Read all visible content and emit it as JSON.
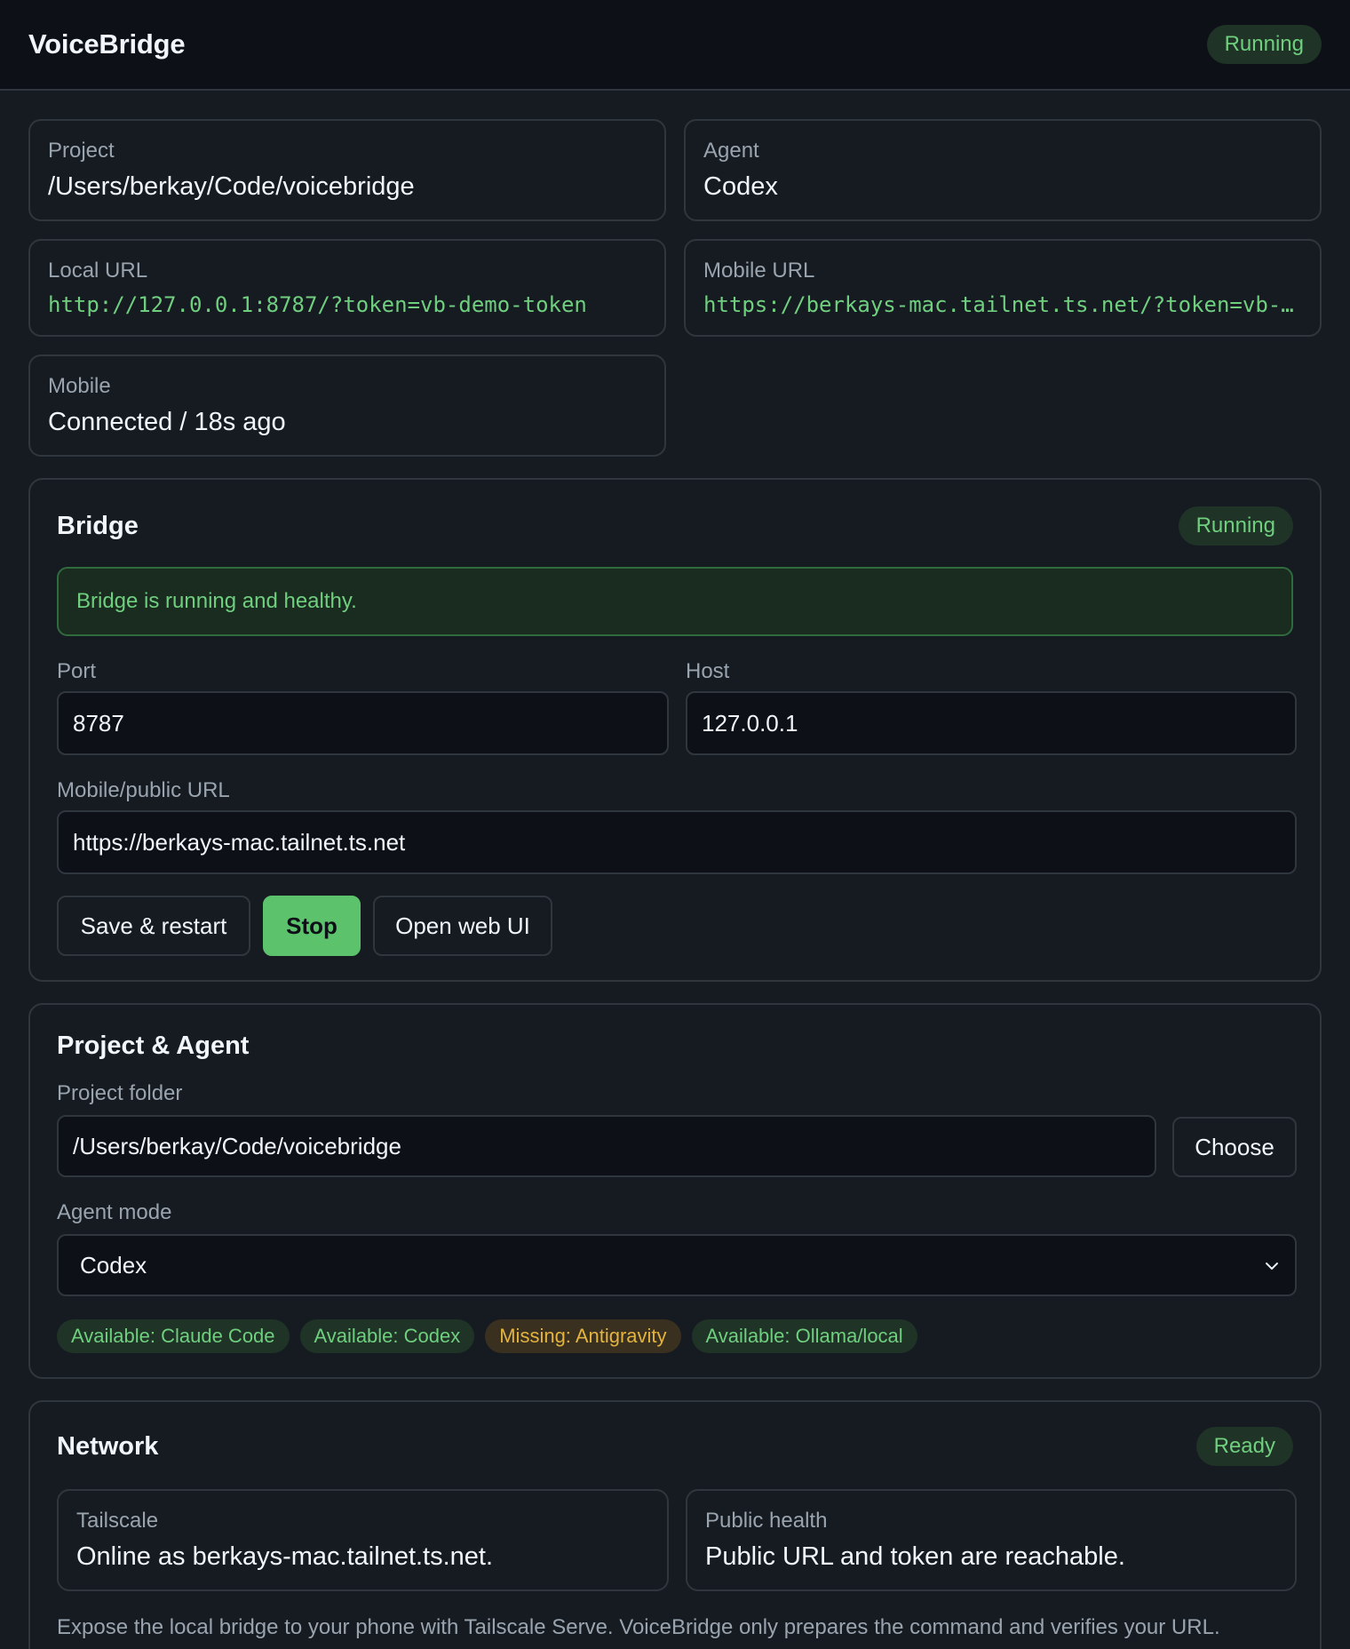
{
  "app": {
    "title": "VoiceBridge",
    "status": "Running"
  },
  "summary": {
    "project": {
      "label": "Project",
      "value": "/Users/berkay/Code/voicebridge"
    },
    "agent": {
      "label": "Agent",
      "value": "Codex"
    },
    "local_url": {
      "label": "Local URL",
      "value": "http://127.0.0.1:8787/?token=vb-demo-token"
    },
    "mobile_url": {
      "label": "Mobile URL",
      "value": "https://berkays-mac.tailnet.ts.net/?token=vb-demo-token"
    },
    "mobile": {
      "label": "Mobile",
      "value": "Connected / 18s ago"
    }
  },
  "bridge": {
    "title": "Bridge",
    "status": "Running",
    "alert": "Bridge is running and healthy.",
    "port": {
      "label": "Port",
      "value": "8787"
    },
    "host": {
      "label": "Host",
      "value": "127.0.0.1"
    },
    "public_url": {
      "label": "Mobile/public URL",
      "value": "https://berkays-mac.tailnet.ts.net"
    },
    "buttons": {
      "save_restart": "Save & restart",
      "stop": "Stop",
      "open_web_ui": "Open web UI"
    }
  },
  "project_agent": {
    "title": "Project & Agent",
    "folder": {
      "label": "Project folder",
      "value": "/Users/berkay/Code/voicebridge",
      "choose": "Choose"
    },
    "mode": {
      "label": "Agent mode",
      "selected": "Codex"
    },
    "chips": [
      {
        "text": "Available: Claude Code",
        "state": "available"
      },
      {
        "text": "Available: Codex",
        "state": "available"
      },
      {
        "text": "Missing: Antigravity",
        "state": "missing"
      },
      {
        "text": "Available: Ollama/local",
        "state": "available"
      }
    ]
  },
  "network": {
    "title": "Network",
    "status": "Ready",
    "tailscale": {
      "label": "Tailscale",
      "value": "Online as berkays-mac.tailnet.ts.net."
    },
    "public_health": {
      "label": "Public health",
      "value": "Public URL and token are reachable."
    },
    "note": "Expose the local bridge to your phone with Tailscale Serve. VoiceBridge only prepares the command and verifies your URL."
  },
  "colors": {
    "accent_green": "#5cc26b",
    "status_green": "#6fcf7f",
    "warning_amber": "#e3b341",
    "background": "#161b22",
    "header_background": "#0d1117",
    "border": "#30363d"
  }
}
